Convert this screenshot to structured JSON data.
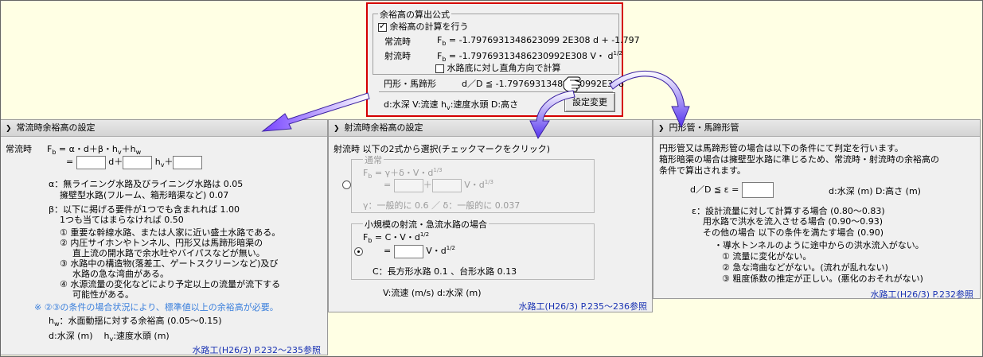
{
  "formula_box": {
    "title": "余裕高の算出公式",
    "calc_checkbox_label": "余裕高の計算を行う",
    "normal_label": "常流時",
    "normal_formula": "F",
    "normal_formula_sub": "b",
    "normal_formula_rest": "= -1.7976931348623099 2E308 d + -1.797",
    "super_label": "射流時",
    "super_formula_rest": "= -1.79769313486230992E308 V・ d",
    "super_formula_sup": "1/2",
    "perp_checkbox_label": "水路底に対し直角方向で計算",
    "circ_label": "円形・馬蹄形",
    "circ_formula": "d／D ≦ -1.79769313486230992E308",
    "legend_text_1": "d:水深 V:流速 h",
    "legend_text_1_sub": "v",
    "legend_text_2": ":速度水頭 D:高さ",
    "change_button": "設定変更"
  },
  "normal_panel": {
    "header": "常流時余裕高の設定",
    "row_label": "常流時",
    "formula_prefix": "F",
    "formula_sub": "b",
    "formula_body": " = α・d＋β・h",
    "formula_hv_sub": "v",
    "formula_end": "＋h",
    "formula_hw_sub": "w",
    "eq": "=",
    "d_plus": "d＋",
    "hv": "h",
    "hv_sub": "v",
    "plus": "＋",
    "alpha_line1": "α：無ライニング水路及びライニング水路は 0.05",
    "alpha_line2": "擁壁型水路(フルーム、箱形暗渠など) 0.07",
    "beta_line1": "β：以下に掲げる要件が1つでも含まれれば 1.00",
    "beta_line2": "1つも当てはまらなければ 0.50",
    "items": [
      "①  重要な幹線水路、または人家に近い盛土水路である。",
      "②  内圧サイホンやトンネル、円形又は馬蹄形暗渠の",
      "直上流の開水路で余水吐やバイパスなどが無い。",
      "③  水路中の構造物(落差工、ゲートスクリーンなど)及び",
      "水路の急な湾曲がある。",
      "④  水源流量の変化などにより予定以上の流量が流下する",
      "可能性がある。"
    ],
    "note": "※ ②③の条件の場合状況により、標準値以上の余裕高が必要。",
    "hw_line": "h",
    "hw_sub": "w",
    "hw_rest": "：水面動揺に対する余裕高 (0.05〜0.15)",
    "d_line": "d:水深 (m)",
    "hv_line_h": "h",
    "hv_line_sub": "v",
    "hv_line_rest": ":速度水頭 (m)",
    "reference": "水路工(H26/3) P.232〜235参照"
  },
  "super_panel": {
    "header": "射流時余裕高の設定",
    "intro": "射流時  以下の2式から選択(チェックマークをクリック)",
    "normal_group_label": "通常",
    "normal_formula": "F",
    "normal_formula_sub": "b",
    "normal_formula_rest": " = γ＋δ・V・d",
    "normal_formula_sup": "1/3",
    "eq": "=",
    "plus": "＋",
    "v_d": "V・d",
    "v_d_sup": "1/3",
    "gamma_delta": "γ：一般的に 0.6    ／  δ：一般的に 0.037",
    "small_group_label": "小規模の射流・急流水路の場合",
    "small_formula": "F",
    "small_formula_sub": "b",
    "small_formula_rest": " = C・V・d",
    "small_formula_sup": "1/2",
    "small_v_d": "V・d",
    "small_v_d_sup": "1/2",
    "c_line": "C：長方形水路 0.1 、台形水路 0.13",
    "units": "V:流速 (m/s)      d:水深 (m)",
    "reference": "水路工(H26/3) P.235〜236参照"
  },
  "circ_panel": {
    "header": "円形管・馬蹄形管",
    "intro1": "円形管又は馬蹄形管の場合は以下の条件にて判定を行います。",
    "intro2": "箱形暗渠の場合は擁壁型水路に準じるため、常流時・射流時の余裕高の",
    "intro3": "条件で算出されます。",
    "formula": "d／D ≦ ε =",
    "units": "d:水深 (m)     D:高さ (m)",
    "eps1": "ε：設計流量に対して計算する場合 (0.80〜0.83)",
    "eps2": "用水路で洪水を流入させる場合 (0.90〜0.93)",
    "eps3": "その他の場合  以下の条件を満たす場合 (0.90)",
    "eps4": "・導水トンネルのように途中からの洪水流入がない。",
    "eps5": "①  流量に変化がない。",
    "eps6": "②  急な湾曲などがない。(流れが乱れない)",
    "eps7": "③  粗度係数の推定が正しい。(悪化のおそれがない)",
    "reference": "水路工(H26/3) P.232参照"
  },
  "colors": {
    "accent_border": "#d40000",
    "arrow": "#5533ee",
    "reference": "#1a33b3",
    "note": "#3a7fdc"
  }
}
